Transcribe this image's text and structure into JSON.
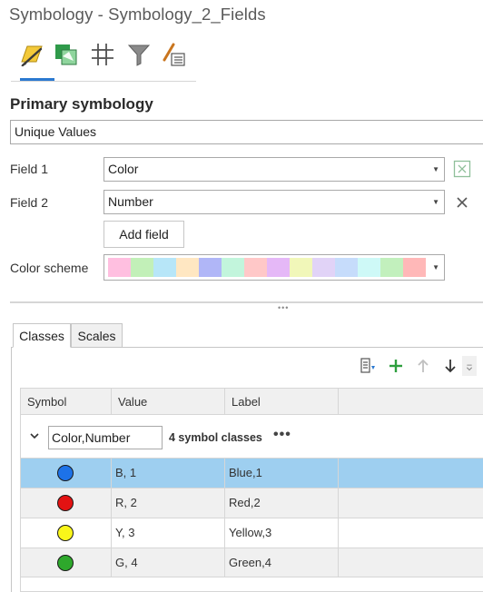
{
  "pane": {
    "title": "Symbology - Symbology_2_Fields"
  },
  "toolbar": {
    "tools": [
      {
        "icon": "primary-symbology-brush-icon"
      },
      {
        "icon": "vary-symbology-icon"
      },
      {
        "icon": "symbol-layer-drawing-icon"
      },
      {
        "icon": "advanced-filter-icon"
      },
      {
        "icon": "label-class-icon"
      }
    ]
  },
  "primary": {
    "title": "Primary symbology",
    "renderer": "Unique Values",
    "field1": {
      "label": "Field 1",
      "value": "Color"
    },
    "field2": {
      "label": "Field 2",
      "value": "Number"
    },
    "add_field": "Add field",
    "color_scheme": {
      "label": "Color scheme",
      "swatches": [
        "#ffbfe0",
        "#c2f0b8",
        "#b7e6f8",
        "#ffe7c2",
        "#b0b6f7",
        "#c2f5dc",
        "#ffc8c8",
        "#e5b8f7",
        "#f1f7b9",
        "#e1d3f7",
        "#c6dcfb",
        "#cef9f7",
        "#c2f0bd",
        "#ffb8b8"
      ]
    }
  },
  "tabs": {
    "classes": "Classes",
    "scales": "Scales"
  },
  "grid": {
    "headers": {
      "symbol": "Symbol",
      "value": "Value",
      "label": "Label"
    },
    "group": {
      "field": "Color,Number",
      "count": "4 symbol classes",
      "more": "•••"
    },
    "rows": [
      {
        "value": "B, 1",
        "label": "Blue,1",
        "color": "#1d72e8"
      },
      {
        "value": "R, 2",
        "label": "Red,2",
        "color": "#e31212"
      },
      {
        "value": "Y, 3",
        "label": "Yellow,3",
        "color": "#f9f51a"
      },
      {
        "value": "G, 4",
        "label": "Green,4",
        "color": "#2ea82c"
      }
    ]
  },
  "colors": {
    "accent": "#2b79d0",
    "selected_row": "#9ecff0",
    "add_green": "#2e9f3e"
  }
}
